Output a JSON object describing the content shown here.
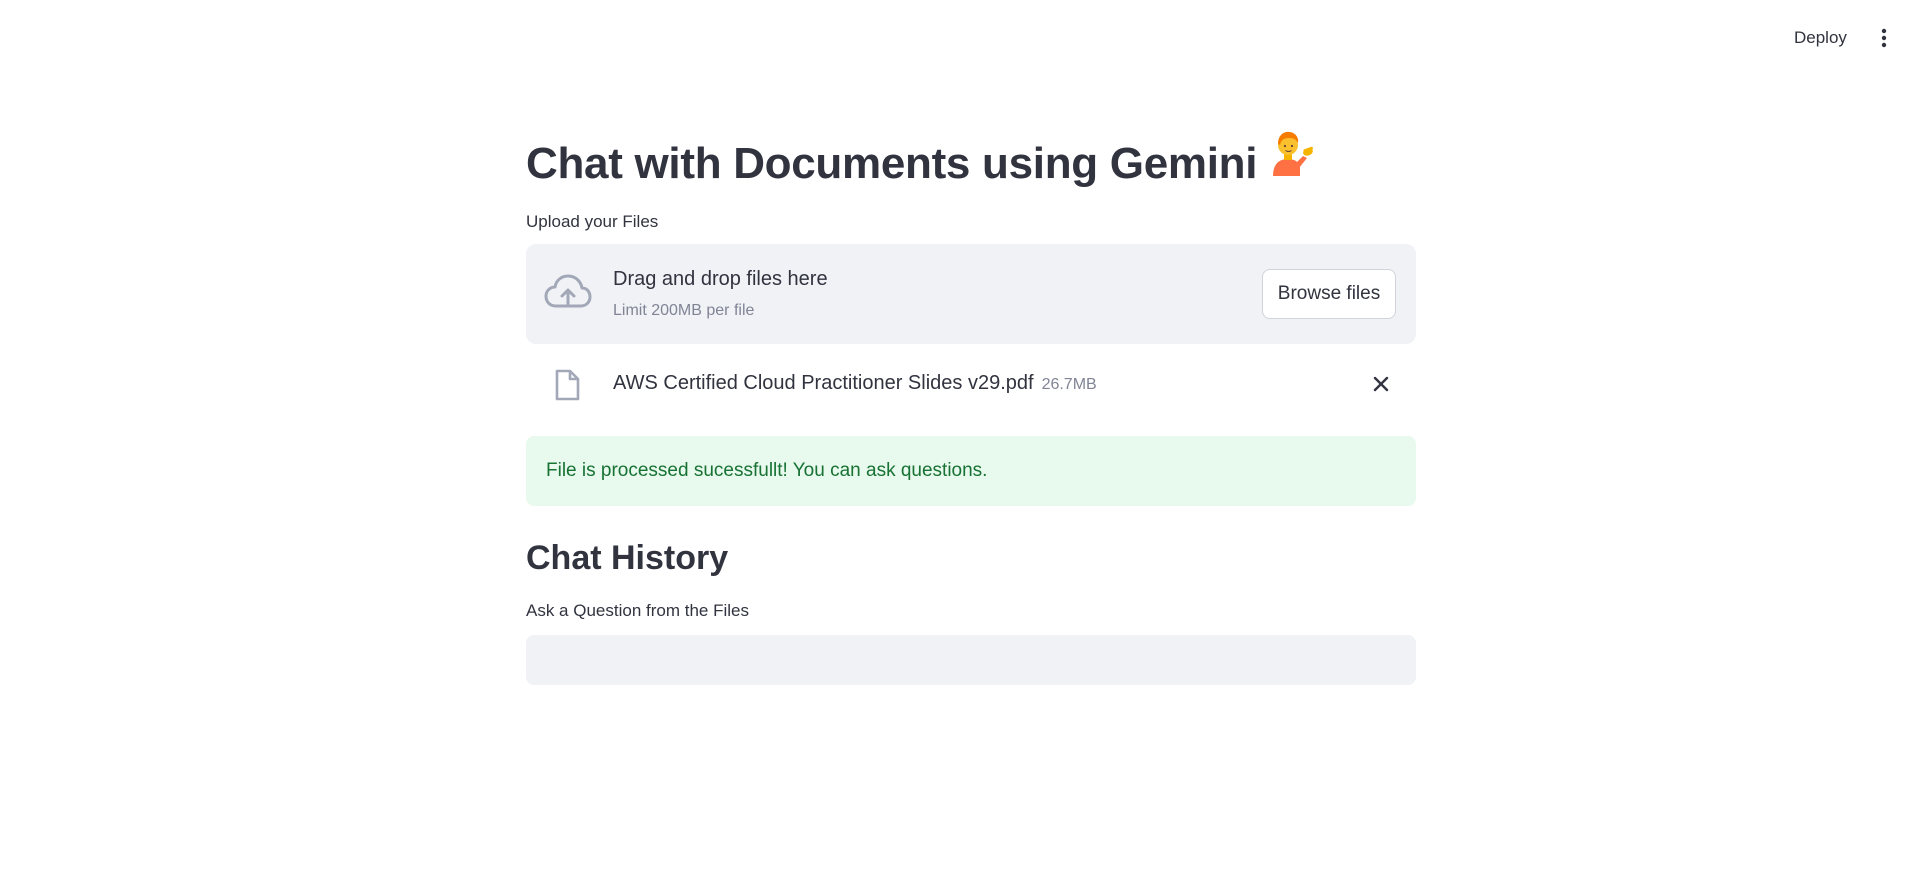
{
  "header": {
    "deploy_label": "Deploy",
    "menu_icon": "vertical-dots-icon"
  },
  "main": {
    "title": "Chat with Documents using Gemini",
    "title_emoji": "person-tipping-hand-emoji",
    "uploader": {
      "label": "Upload your Files",
      "drag_text": "Drag and drop files here",
      "limit_text": "Limit 200MB per file",
      "browse_label": "Browse files",
      "icon": "cloud-upload-icon"
    },
    "uploaded_file": {
      "name": "AWS Certified Cloud Practitioner Slides v29.pdf",
      "size": "26.7MB",
      "icon": "file-icon",
      "remove_icon": "close-icon"
    },
    "success_message": "File is processed sucessfullt! You can ask questions.",
    "chat_history_heading": "Chat History",
    "question": {
      "label": "Ask a Question from the Files",
      "value": "",
      "placeholder": ""
    }
  },
  "colors": {
    "text": "#31333f",
    "muted": "#808495",
    "input_bg": "#f0f2f6",
    "success_bg": "#e8f9ee",
    "success_text": "#177233"
  }
}
